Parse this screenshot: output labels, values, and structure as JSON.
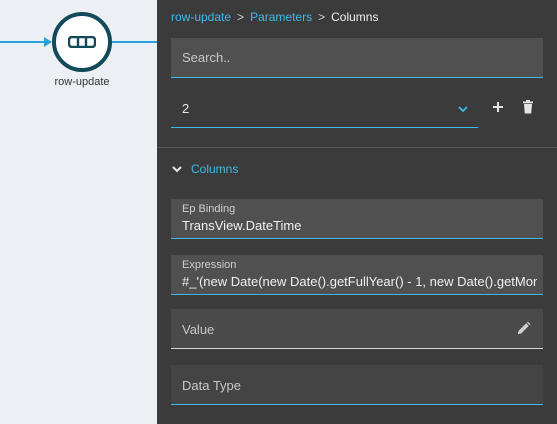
{
  "node": {
    "label": "row-update"
  },
  "breadcrumb": {
    "items": [
      "row-update",
      "Parameters"
    ],
    "current": "Columns",
    "separator": ">"
  },
  "search": {
    "placeholder": "Search.."
  },
  "param_select": {
    "value": "2"
  },
  "icons": {
    "node": "table-row-icon",
    "chevron": "chevron-down-icon",
    "add": "plus-icon",
    "delete": "trash-icon",
    "edit": "pencil-icon"
  },
  "section": {
    "title": "Columns"
  },
  "fields": {
    "ep_binding": {
      "label": "Ep Binding",
      "value": "TransView.DateTime"
    },
    "expression": {
      "label": "Expression",
      "value": "#_'(new Date(new Date().getFullYear() - 1, new Date().getMor"
    },
    "value": {
      "placeholder": "Value"
    },
    "data_type": {
      "placeholder": "Data Type"
    }
  },
  "colors": {
    "accent": "#3dbbe8",
    "node_ring": "#134a5a",
    "panel_bg": "#3b3b3b",
    "field_bg": "#505050"
  }
}
